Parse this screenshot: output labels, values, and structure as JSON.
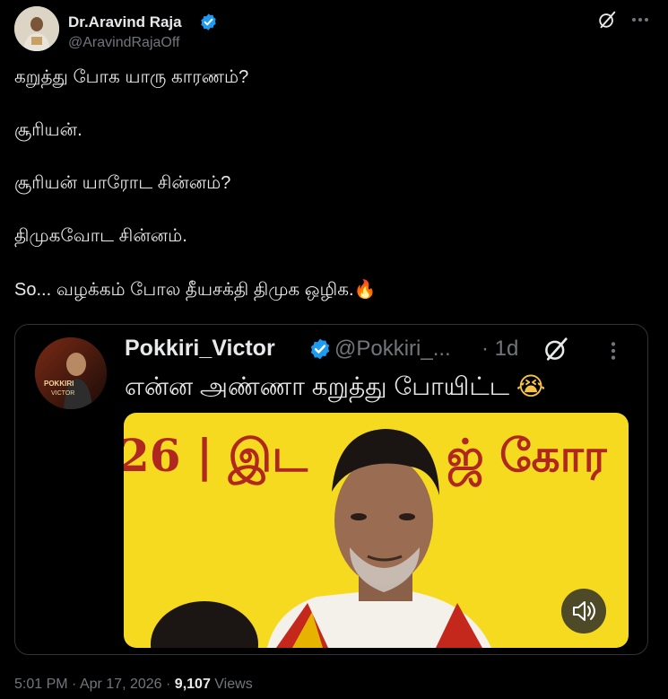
{
  "author": {
    "name": "Dr.Aravind Raja",
    "handle": "@AravindRajaOff",
    "verified": true
  },
  "tweet": {
    "lines": [
      "கறுத்து போக யாரு காரணம்?",
      "சூரியன்.",
      "சூரியன் யாரோட சின்னம்?",
      "திமுகவோட சின்னம்.",
      "So... வழக்கம் போல தீயசக்தி திமுக ஒழிக."
    ],
    "emoji": "🔥"
  },
  "quote": {
    "name": "Pokkiri_Victor",
    "handle": "@Pokkiri_...",
    "time": "· 1d",
    "text": "என்ன அண்ணா கறுத்து போயிட்ட",
    "emoji": "😭",
    "avatar_text": [
      "POKKIRI",
      "VICTOR"
    ],
    "media": {
      "banner_left": "26 | இட",
      "banner_right": "ஜ் கோர"
    }
  },
  "footer": {
    "time": "5:01 PM",
    "separator": "·",
    "date": "Apr 17, 2026",
    "views_count": "9,107",
    "views_label": "Views"
  },
  "colors": {
    "background": "#000000",
    "text": "#e7e9ea",
    "secondary": "#71767b",
    "verified": "#1d9bf0",
    "border": "#2f3336"
  },
  "icons": [
    "verified-badge-icon",
    "grok-icon",
    "more-icon",
    "sound-icon"
  ]
}
